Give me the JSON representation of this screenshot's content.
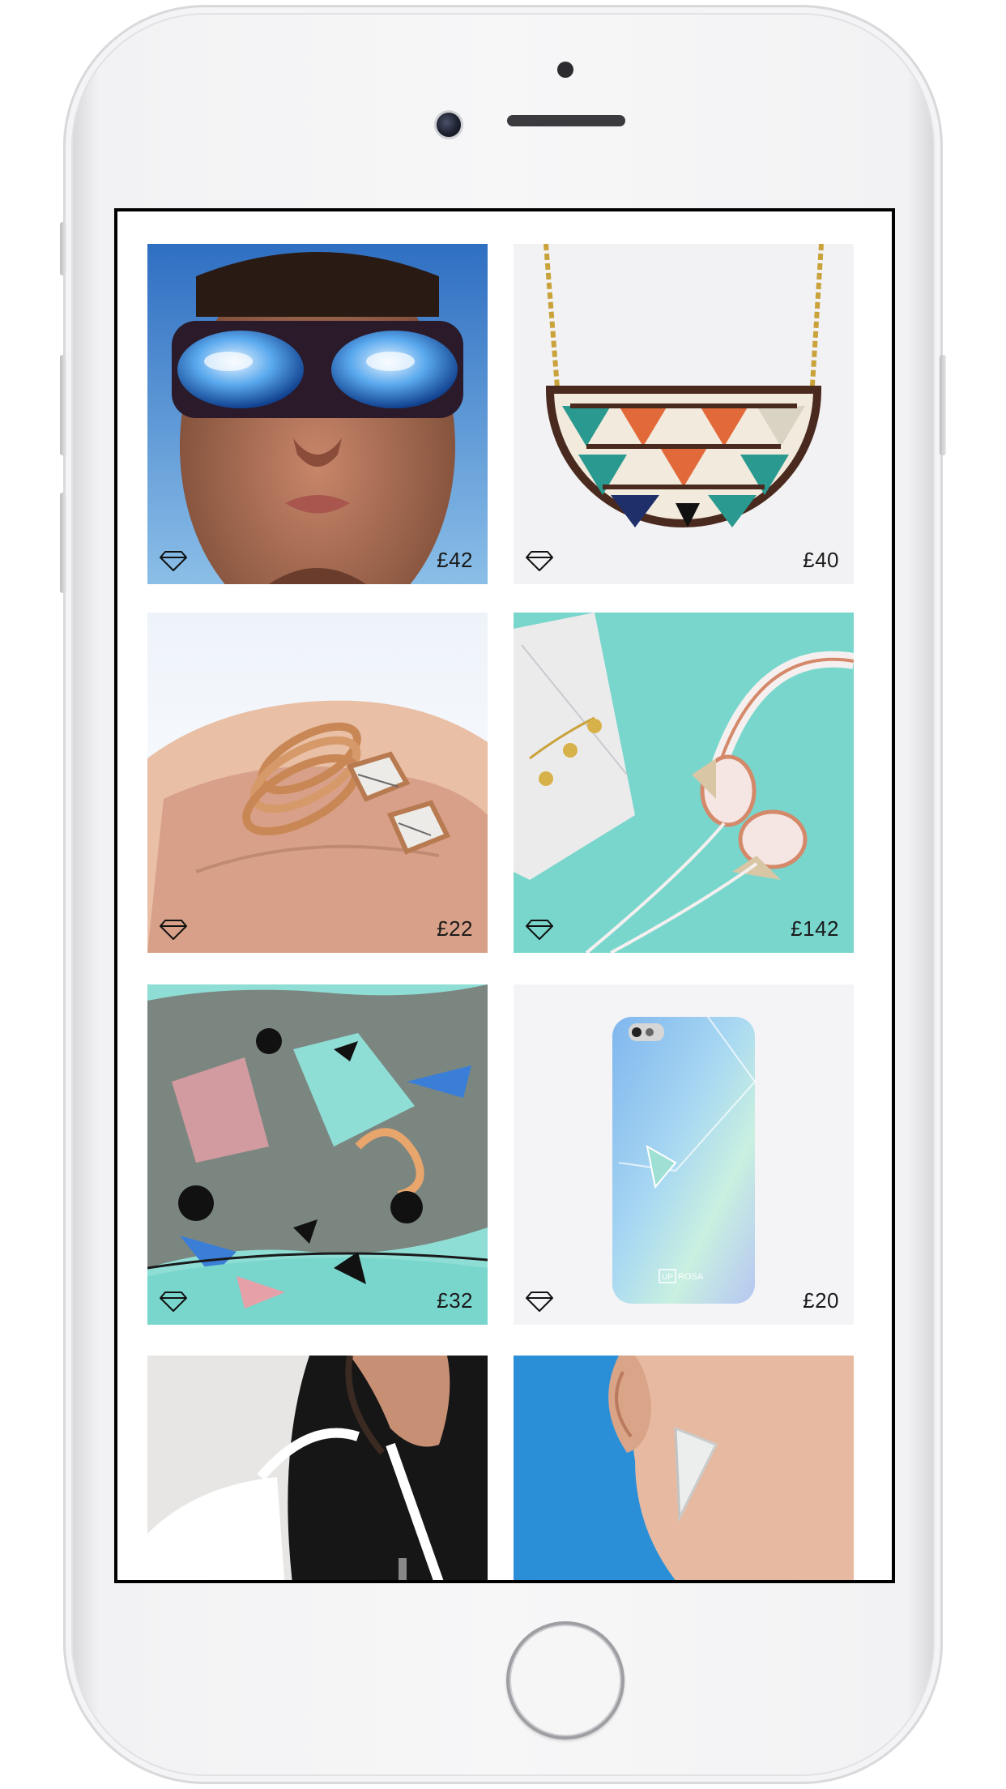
{
  "products": [
    {
      "price": "£42",
      "image": "sunglasses-portrait",
      "icon": "diamond-icon"
    },
    {
      "price": "£40",
      "image": "geometric-necklace",
      "icon": "diamond-icon"
    },
    {
      "price": "£22",
      "image": "marble-rings",
      "icon": "diamond-icon"
    },
    {
      "price": "£142",
      "image": "rose-gold-headphones",
      "icon": "diamond-icon"
    },
    {
      "price": "£32",
      "image": "abstract-silk-scarf",
      "icon": "diamond-icon"
    },
    {
      "price": "£20",
      "image": "holographic-phone-case",
      "icon": "diamond-icon"
    },
    {
      "image": "white-backpack-leather-jacket"
    },
    {
      "image": "geometric-earring"
    }
  ],
  "phone_case_logo": {
    "box_text": "UP",
    "text": "ROSA"
  },
  "colors": {
    "screen_border": "#000000",
    "price_text": "#1a1a1a",
    "mint": "#79d6cc",
    "sky_blue": "#2b8fd8"
  }
}
